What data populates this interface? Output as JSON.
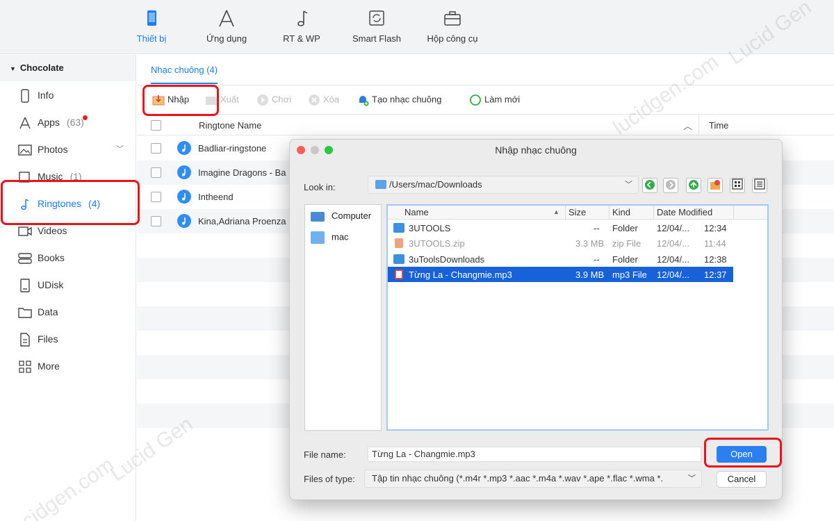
{
  "topnav": {
    "items": [
      {
        "label": "Thiết bị",
        "icon": "phone-icon",
        "active": true
      },
      {
        "label": "Ứng dụng",
        "icon": "appstore-icon",
        "active": false
      },
      {
        "label": "RT & WP",
        "icon": "music-note-icon",
        "active": false
      },
      {
        "label": "Smart Flash",
        "icon": "refresh-box-icon",
        "active": false
      },
      {
        "label": "Hộp công cụ",
        "icon": "toolbox-icon",
        "active": false
      }
    ]
  },
  "sidebar": {
    "device_name": "Chocolate",
    "items": [
      {
        "label": "Info",
        "count": "",
        "icon": "phone-icon"
      },
      {
        "label": "Apps",
        "count": "(63)",
        "icon": "appstore-icon",
        "badge": true
      },
      {
        "label": "Photos",
        "count": "",
        "icon": "photo-icon",
        "expandable": true
      },
      {
        "label": "Music",
        "count": "(1)",
        "icon": "music-note-icon"
      },
      {
        "label": "Ringtones",
        "count": "(4)",
        "icon": "bell-note-icon",
        "active": true
      },
      {
        "label": "Videos",
        "count": "",
        "icon": "video-icon"
      },
      {
        "label": "Books",
        "count": "",
        "icon": "books-icon"
      },
      {
        "label": "UDisk",
        "count": "",
        "icon": "udisk-icon"
      },
      {
        "label": "Data",
        "count": "",
        "icon": "folder-icon"
      },
      {
        "label": "Files",
        "count": "",
        "icon": "file-icon"
      },
      {
        "label": "More",
        "count": "",
        "icon": "grid-icon"
      }
    ]
  },
  "content": {
    "tab_label": "Nhạc chuông (4)",
    "toolbar": {
      "import": "Nhập",
      "export": "Xuất",
      "play": "Chơi",
      "delete": "Xóa",
      "create": "Tạo nhạc chuông",
      "refresh": "Làm mới"
    },
    "columns": {
      "name": "Ringtone Name",
      "time": "Time"
    },
    "rows": [
      {
        "name": "Badliar-ringstone"
      },
      {
        "name": "Imagine Dragons - Ba"
      },
      {
        "name": "Intheend"
      },
      {
        "name": "Kina,Adriana Proenza"
      }
    ]
  },
  "dialog": {
    "title": "Nhập nhạc chuông",
    "look_in_label": "Look in:",
    "path": "/Users/mac/Downloads",
    "places": [
      {
        "label": "Computer",
        "icon": "computer-icon"
      },
      {
        "label": "mac",
        "icon": "home-folder-icon"
      }
    ],
    "columns": {
      "name": "Name",
      "size": "Size",
      "kind": "Kind",
      "date": "Date Modified"
    },
    "files": [
      {
        "name": "3UTOOLS",
        "size": "--",
        "kind": "Folder",
        "date": "12/04/...",
        "time": "12:34",
        "icon": "folder-icon",
        "selected": false,
        "dim": false
      },
      {
        "name": "3UTOOLS.zip",
        "size": "3.3 MB",
        "kind": "zip File",
        "date": "12/04/...",
        "time": "11:44",
        "icon": "zip-file-icon",
        "selected": false,
        "dim": true
      },
      {
        "name": "3uToolsDownloads",
        "size": "--",
        "kind": "Folder",
        "date": "12/04/...",
        "time": "12:38",
        "icon": "folder-icon",
        "selected": false,
        "dim": false
      },
      {
        "name": "Từng La - Changmie.mp3",
        "size": "3.9 MB",
        "kind": "mp3 File",
        "date": "12/04/...",
        "time": "12:37",
        "icon": "mp3-file-icon",
        "selected": true,
        "dim": false
      }
    ],
    "file_name_label": "File name:",
    "file_name_value": "Từng La - Changmie.mp3",
    "file_type_label": "Files of type:",
    "file_type_value": "Tập tin nhạc chuông (*.m4r *.mp3 *.aac *.m4a *.wav *.ape *.flac *.wma *.",
    "open_label": "Open",
    "cancel_label": "Cancel"
  },
  "watermark": [
    "Lucid Gen",
    "lucidgen.com"
  ],
  "colors": {
    "accent": "#1a7cf0",
    "highlight": "#e8141b",
    "selection": "#1762d8"
  }
}
